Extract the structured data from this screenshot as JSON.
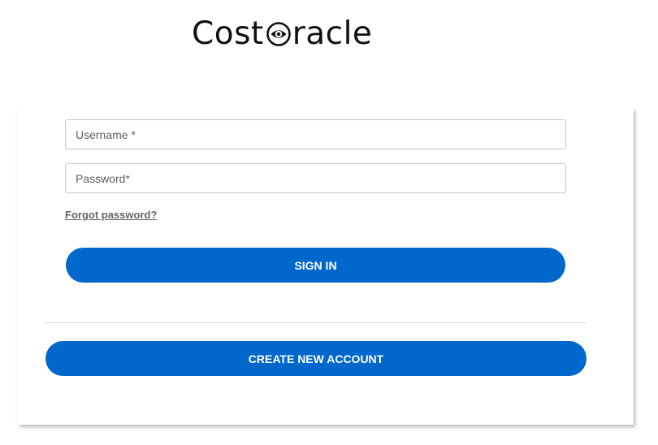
{
  "logo": {
    "text_before": "Cost",
    "text_after": "racle",
    "icon": "eye-o-icon"
  },
  "form": {
    "username_placeholder": "Username *",
    "password_placeholder": "Password*",
    "forgot_password": "Forgot password?",
    "sign_in_label": "SIGN IN",
    "create_account_label": "CREATE NEW ACCOUNT"
  },
  "colors": {
    "primary_button": "#0067cc",
    "link": "#666666"
  }
}
